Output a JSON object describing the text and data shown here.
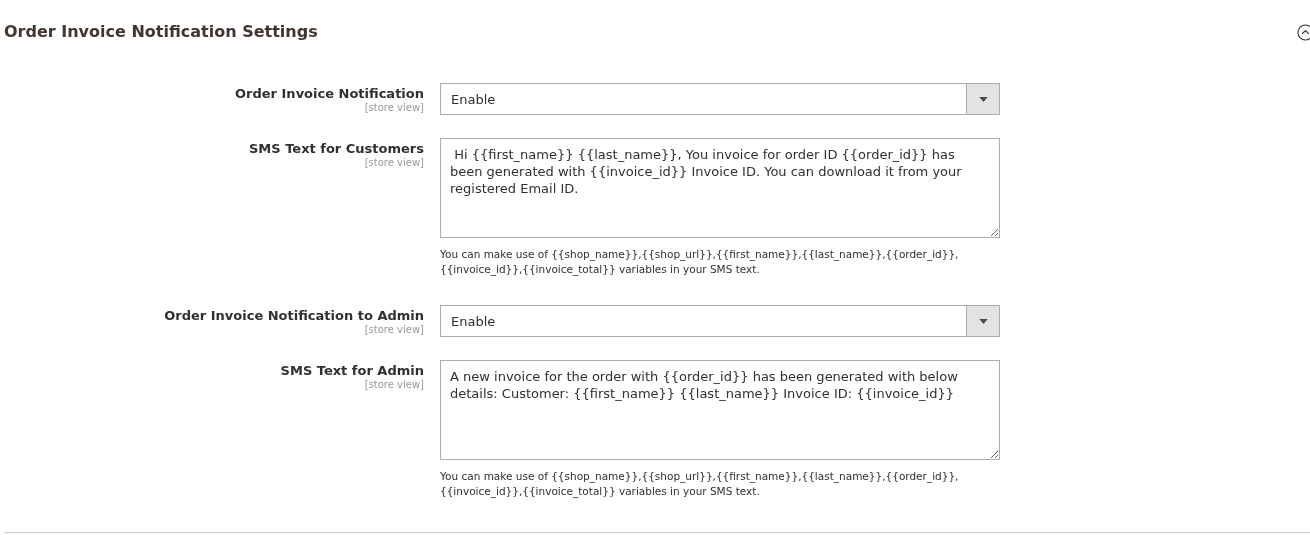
{
  "section": {
    "title": "Order Invoice Notification Settings",
    "expanded": true
  },
  "fields": [
    {
      "kind": "select",
      "label": "Order Invoice Notification",
      "scope": "[store view]",
      "value": "Enable"
    },
    {
      "kind": "textarea",
      "label": "SMS Text for Customers",
      "scope": "[store view]",
      "value": " Hi {{first_name}} {{last_name}}, You invoice for order ID {{order_id}} has been generated with {{invoice_id}} Invoice ID. You can download it from your registered Email ID.",
      "note": "You can make use of {{shop_name}},{{shop_url}},{{first_name}},{{last_name}},{{order_id}}, {{invoice_id}},{{invoice_total}} variables in your SMS text."
    },
    {
      "kind": "select",
      "label": "Order Invoice Notification to Admin",
      "scope": "[store view]",
      "value": "Enable"
    },
    {
      "kind": "textarea",
      "label": "SMS Text for Admin",
      "scope": "[store view]",
      "value": "A new invoice for the order with {{order_id}} has been generated with below details: Customer: {{first_name}} {{last_name}} Invoice ID: {{invoice_id}}",
      "note": "You can make use of {{shop_name}},{{shop_url}},{{first_name}},{{last_name}},{{order_id}}, {{invoice_id}},{{invoice_total}} variables in your SMS text."
    }
  ]
}
